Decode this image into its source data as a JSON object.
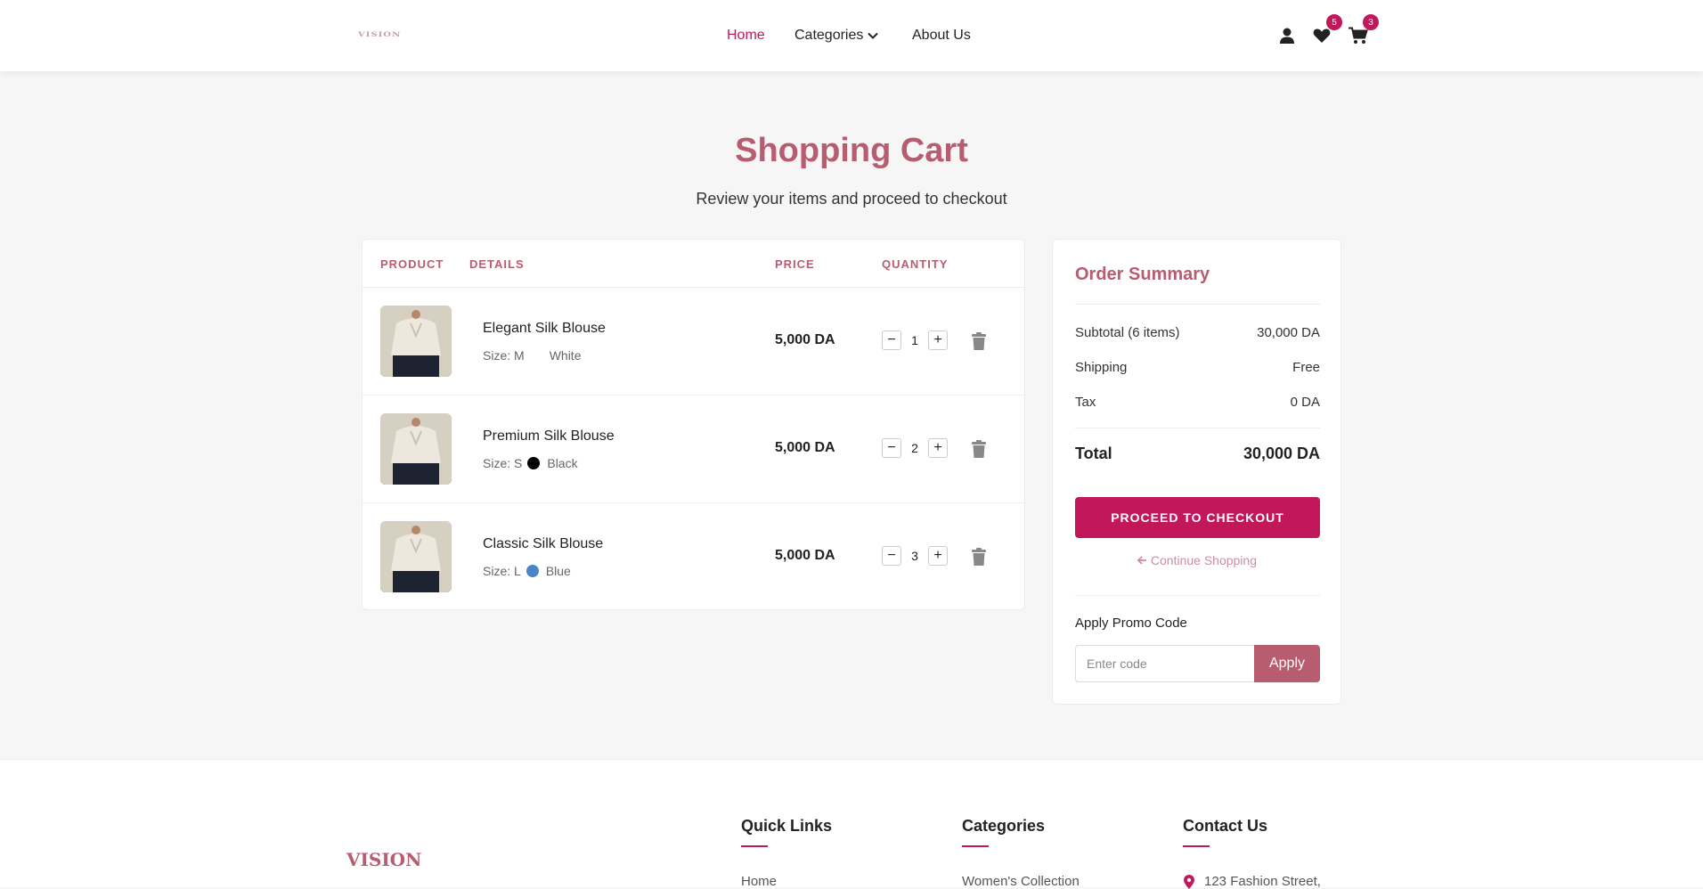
{
  "header": {
    "logo_text": "VISION",
    "nav": [
      {
        "label": "Home",
        "active": true
      },
      {
        "label": "Categories",
        "active": false
      },
      {
        "label": "About Us",
        "active": false
      }
    ],
    "wishlist_count": "5",
    "cart_count": "3"
  },
  "page": {
    "title": "Shopping Cart",
    "subtitle": "Review your items and proceed to checkout"
  },
  "cart": {
    "columns": [
      "PRODUCT",
      "DETAILS",
      "PRICE",
      "QUANTITY"
    ],
    "items": [
      {
        "name": "Elegant Silk Blouse",
        "size": "Size: M",
        "color_name": "White",
        "color": "#ffffff",
        "price": "5,000 DA",
        "quantity": "1"
      },
      {
        "name": "Premium Silk Blouse",
        "size": "Size: S",
        "color_name": "Black",
        "color": "#000000",
        "price": "5,000 DA",
        "quantity": "2"
      },
      {
        "name": "Classic Silk Blouse",
        "size": "Size: L",
        "color_name": "Blue",
        "color": "#4a86c5",
        "price": "5,000 DA",
        "quantity": "3"
      }
    ],
    "minus_label": "−",
    "plus_label": "+"
  },
  "summary": {
    "title": "Order Summary",
    "subtotal_label": "Subtotal (6 items)",
    "subtotal_value": "30,000 DA",
    "shipping_label": "Shipping",
    "shipping_value": "Free",
    "tax_label": "Tax",
    "tax_value": "0 DA",
    "total_label": "Total",
    "total_value": "30,000 DA",
    "checkout_label": "PROCEED TO CHECKOUT",
    "continue_label": "Continue Shopping",
    "promo_label": "Apply Promo Code",
    "promo_placeholder": "Enter code",
    "apply_label": "Apply"
  },
  "footer": {
    "logo_text": "VISION",
    "quick_links_title": "Quick Links",
    "quick_links_first": "Home",
    "categories_title": "Categories",
    "categories_first": "Women's Collection",
    "contact_title": "Contact Us",
    "contact_first": "123 Fashion Street,"
  },
  "colors": {
    "brand": "#c2185b",
    "accent": "#b85c70"
  }
}
